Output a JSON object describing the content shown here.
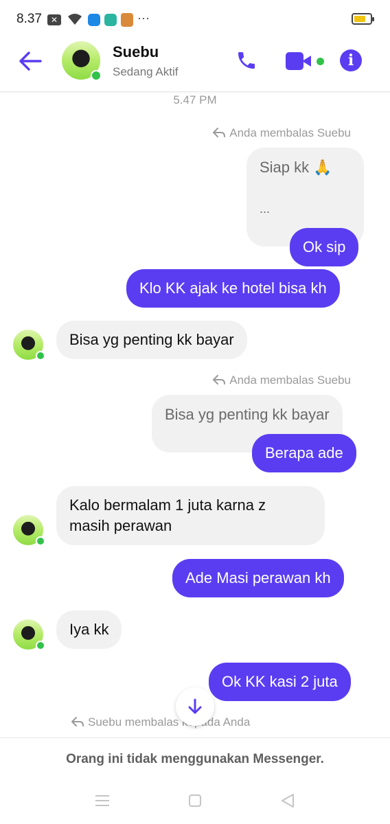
{
  "status_bar": {
    "time": "8.37",
    "more": "···"
  },
  "header": {
    "contact_name": "Suebu",
    "contact_status": "Sedang Aktif",
    "accent_color": "#5a3df1"
  },
  "conversation": {
    "timestamp": "5.47 PM",
    "reply_note_1": "Anda membalas Suebu",
    "quoted_1_line1": "Siap kk 🙏",
    "quoted_1_line2": "...",
    "msg_1": "Ok sip",
    "msg_2": "Klo KK ajak ke hotel bisa kh",
    "msg_3": "Bisa yg penting kk bayar",
    "reply_note_2": "Anda membalas Suebu",
    "quoted_2": "Bisa yg penting kk bayar",
    "msg_4": "Berapa ade",
    "msg_5_line1": "Kalo bermalam 1 juta karna z",
    "msg_5_line2": "masih perawan",
    "msg_6": "Ade Masi perawan kh",
    "msg_7": "Iya kk",
    "msg_8": "Ok KK kasi 2 juta",
    "reply_note_3": "Suebu membalas kepada Anda"
  },
  "footer": {
    "notice": "Orang ini tidak menggunakan Messenger."
  },
  "icons": [
    "back-arrow-icon",
    "phone-icon",
    "video-call-icon",
    "info-icon",
    "reply-icon",
    "arrow-down-icon",
    "menu-nav-icon",
    "home-nav-icon",
    "back-nav-icon"
  ]
}
